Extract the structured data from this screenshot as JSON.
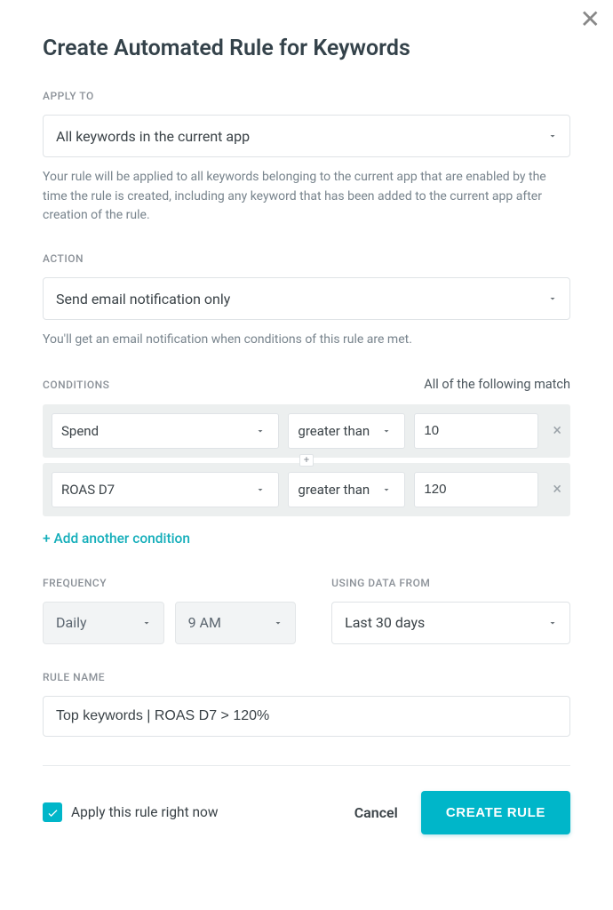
{
  "title": "Create Automated Rule for Keywords",
  "close_glyph": "✕",
  "apply_to": {
    "label": "APPLY TO",
    "selected": "All keywords in the current app",
    "helper": "Your rule will be applied to all keywords belonging to the current app that are enabled by the time the rule is created, including any keyword that has been added to the current app after creation of the rule."
  },
  "action": {
    "label": "ACTION",
    "selected": "Send email notification only",
    "helper": "You'll get an email notification when conditions of this rule are met."
  },
  "conditions": {
    "label": "CONDITIONS",
    "match_text": "All of the following match",
    "rows": [
      {
        "field": "Spend",
        "operator": "greater than",
        "value": "10"
      },
      {
        "field": "ROAS D7",
        "operator": "greater than",
        "value": "120"
      }
    ],
    "add_text": "+ Add another condition",
    "plus_badge": "+",
    "remove_glyph": "×"
  },
  "frequency": {
    "label": "FREQUENCY",
    "interval": "Daily",
    "time": "9 AM"
  },
  "data_from": {
    "label": "USING DATA FROM",
    "selected": "Last 30 days"
  },
  "rule_name": {
    "label": "RULE NAME",
    "value": "Top keywords | ROAS D7 > 120%"
  },
  "footer": {
    "apply_now_label": "Apply this rule right now",
    "apply_now_checked": true,
    "cancel": "Cancel",
    "submit": "CREATE RULE"
  },
  "colors": {
    "accent": "#00b6c9"
  }
}
